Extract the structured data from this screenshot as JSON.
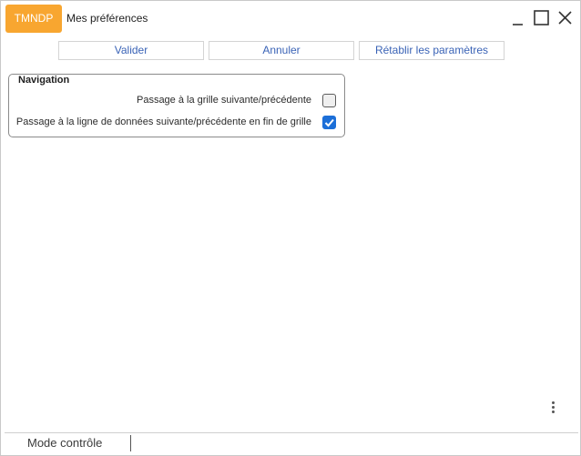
{
  "app": {
    "badge": "TMNDP",
    "title": "Mes préférences"
  },
  "window_controls": {
    "minimize": "minimize-icon",
    "maximize": "maximize-icon",
    "close": "close-icon"
  },
  "toolbar": {
    "validate_label": "Valider",
    "cancel_label": "Annuler",
    "reset_label": "Rétablir les paramètres"
  },
  "navigation": {
    "legend": "Navigation",
    "options": [
      {
        "label": "Passage à la grille suivante/précédente",
        "checked": false
      },
      {
        "label": "Passage à la ligne de données suivante/précédente en fin de grille",
        "checked": true
      }
    ]
  },
  "statusbar": {
    "mode": "Mode contrôle"
  },
  "colors": {
    "accent": "#f8a630",
    "link": "#3a63b6",
    "checkbox_on": "#1c6fd8"
  }
}
